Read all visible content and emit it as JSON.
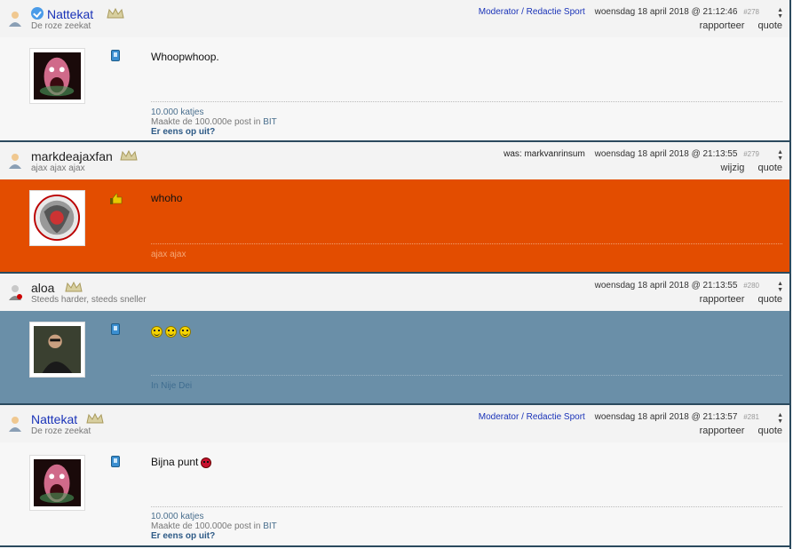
{
  "posts": [
    {
      "username": "Nattekat",
      "subtitle": "De roze zeekat",
      "role": "Moderator / Redactie Sport",
      "was": "",
      "timestamp": "woensdag 18 april 2018 @ 21:12:46",
      "post_number": "#278",
      "actions": [
        "rapporteer",
        "quote"
      ],
      "content": "Whoopwhoop.",
      "signature": [
        "10.000 katjes",
        "Maakte de 100.000e post in",
        "BIT",
        "Er eens op uit?"
      ],
      "body_color": "#f7f7f7"
    },
    {
      "username": "markdeajaxfan",
      "subtitle": "ajax ajax ajax",
      "role": "",
      "was": "was: markvanrinsum",
      "timestamp": "woensdag 18 april 2018 @ 21:13:55",
      "post_number": "#279",
      "actions": [
        "wijzig",
        "quote"
      ],
      "content": "whoho",
      "signature": [
        "ajax ajax"
      ],
      "body_color": "#e34d00"
    },
    {
      "username": "aloa",
      "subtitle": "Steeds harder, steeds sneller",
      "role": "",
      "was": "",
      "timestamp": "woensdag 18 april 2018 @ 21:13:55",
      "post_number": "#280",
      "actions": [
        "rapporteer",
        "quote"
      ],
      "content": "",
      "signature": [
        "In Nije Dei"
      ],
      "body_color": "#6a8fa8"
    },
    {
      "username": "Nattekat",
      "subtitle": "De roze zeekat",
      "role": "Moderator / Redactie Sport",
      "was": "",
      "timestamp": "woensdag 18 april 2018 @ 21:13:57",
      "post_number": "#281",
      "actions": [
        "rapporteer",
        "quote"
      ],
      "content": "Bijna punt",
      "signature": [
        "10.000 katjes",
        "Maakte de 100.000e post in",
        "BIT",
        "Er eens op uit?"
      ],
      "body_color": "#f7f7f7"
    }
  ]
}
